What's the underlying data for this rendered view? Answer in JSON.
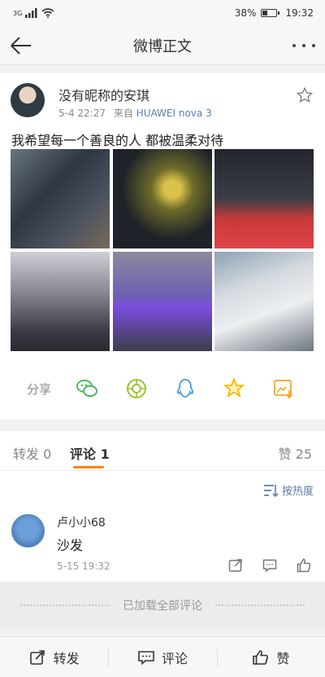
{
  "status_bar": {
    "network": "3G",
    "battery_pct_text": "38%",
    "battery_level": 0.38,
    "time": "19:32"
  },
  "header": {
    "title": "微博正文"
  },
  "post": {
    "username": "没有昵称的安琪",
    "date": "5-4 22:27",
    "source_prefix": "来自",
    "device": "HUAWEI nova 3",
    "text": "我希望每一个善良的人 都被温柔对待",
    "images": [
      "photo",
      "photo",
      "photo",
      "photo",
      "photo",
      "photo"
    ]
  },
  "share": {
    "label": "分享",
    "icons": [
      "wechat-icon",
      "moments-icon",
      "qq-icon",
      "qzone-icon",
      "save-image-icon"
    ],
    "colors": {
      "wechat": "#3db54a",
      "moments": "#8fc31f",
      "qq": "#3f9fe0",
      "qzone": "#f5b700",
      "save": "#f5a623"
    }
  },
  "tabs": {
    "repost": "转发 0",
    "comment": "评论 1",
    "like": "赞 25",
    "accent": "#ff8200"
  },
  "comments": {
    "sort_label": "按热度",
    "items": [
      {
        "name": "卢小小68",
        "text": "沙发",
        "time": "5-15 19:32"
      }
    ],
    "loaded_text": "已加载全部评论"
  },
  "bottom_bar": {
    "repost": "转发",
    "comment": "评论",
    "like": "赞"
  }
}
